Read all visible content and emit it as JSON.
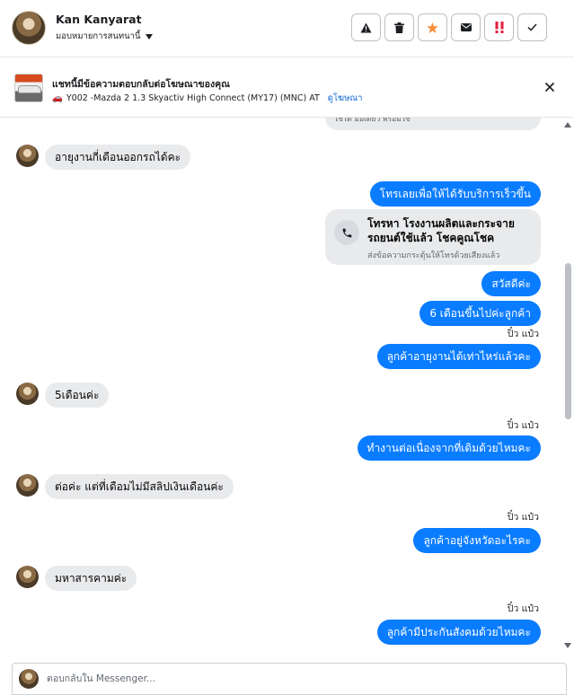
{
  "header": {
    "contact_name": "Kan Kanyarat",
    "assign_label": "มอบหมายการสนทนานี้",
    "actions": [
      {
        "name": "report-button",
        "icon": "warning-icon",
        "color": "#1c1e21"
      },
      {
        "name": "delete-button",
        "icon": "trash-icon",
        "color": "#1c1e21"
      },
      {
        "name": "star-button",
        "icon": "star-icon",
        "color": "#f7923b"
      },
      {
        "name": "mark-unread-button",
        "icon": "envelope-icon",
        "color": "#1c1e21"
      },
      {
        "name": "spam-button",
        "icon": "exclamation-icon",
        "color": "#e41e3f"
      },
      {
        "name": "done-button",
        "icon": "checkmark-icon",
        "color": "#1c1e21"
      }
    ]
  },
  "ad_banner": {
    "title": "แชทนี้มีข้อความตอบกลับต่อโฆษณาของคุณ",
    "ad_emoji": "🚗",
    "ad_name": "Y002 -Mazda 2 1.3 Skyactiv High Connect (MY17) (MNC) AT",
    "view_ad_label": "ดูโฆษณา"
  },
  "thread": {
    "prev_card_text": "ใช้ได้ มือเดียว พร้อมใช้",
    "messages": [
      {
        "dir": "in",
        "text": "อายุงานกี่เดือนออกรถได้คะ"
      },
      {
        "dir": "out",
        "text": "โทรเลยเพื่อให้ได้รับบริการเร็วขึ้น"
      },
      {
        "dir": "out",
        "text": "สวัสดีค่ะ"
      },
      {
        "dir": "out",
        "text": "6 เดือนขึ้นไปค่ะลูกค้า"
      },
      {
        "dir": "out",
        "text": "ลูกค้าอายุงานได้เท่าไหร่แล้วคะ"
      },
      {
        "dir": "in",
        "text": "5เดือนค่ะ"
      },
      {
        "dir": "out",
        "text": "ทำงานต่อเนื่องจากที่เดิมด้วยไหมคะ"
      },
      {
        "dir": "in",
        "text": "ต่อค่ะ แต่ที่เดือมไม่มีสลิปเงินเดือนค่ะ"
      },
      {
        "dir": "out",
        "text": "ลูกค้าอยู่จังหวัดอะไรคะ"
      },
      {
        "dir": "in",
        "text": "มหาสารคามค่ะ"
      },
      {
        "dir": "out",
        "text": "ลูกค้ามีประกันสังคมด้วยไหมคะ"
      }
    ],
    "call_card": {
      "title": "โทรหา โรงงานผลิตและกระจายรถยนต์ใช้แล้ว โชคคูณโชค",
      "subtitle": "ส่งข้อความกระตุ้นให้โทรด้วยเสียงแล้ว"
    },
    "seen_label": "ปิ๋ว แป๋ว"
  },
  "composer": {
    "placeholder": "ตอบกลับใน Messenger..."
  },
  "colors": {
    "outgoing_bubble": "#0a7cff",
    "incoming_bubble": "#e9eaec",
    "link": "#0a66d8"
  }
}
